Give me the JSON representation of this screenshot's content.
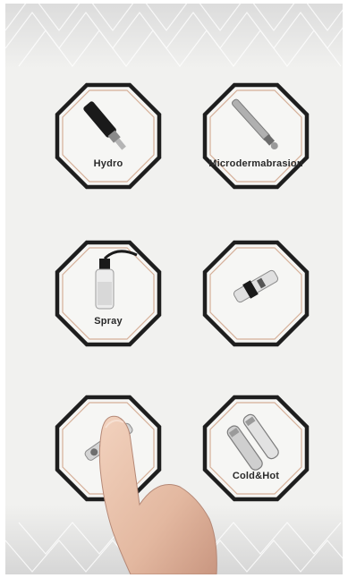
{
  "tiles": [
    {
      "label": "Hydro",
      "icon": "hydro-handpiece-icon"
    },
    {
      "label": "Microdermabrasion",
      "icon": "microdermabrasion-wand-icon"
    },
    {
      "label": "Spray",
      "icon": "spray-bottle-icon"
    },
    {
      "label": "",
      "icon": "ultrasonic-probe-icon"
    },
    {
      "label": "",
      "icon": "bio-lift-handpiece-icon"
    },
    {
      "label": "Cold&Hot",
      "icon": "cold-hot-hammer-icon"
    }
  ],
  "colors": {
    "background": "#f1f1ef",
    "octagon_border": "#1e1e1e",
    "accent_line": "#c89270"
  }
}
